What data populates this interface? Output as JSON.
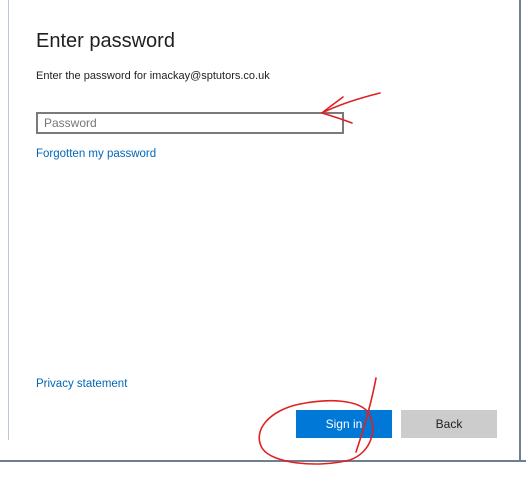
{
  "dialog": {
    "title": "Enter password",
    "subtitle": "Enter the password for imackay@sptutors.co.uk",
    "password_placeholder": "Password",
    "forgot_link": "Forgotten my password",
    "privacy_link": "Privacy statement"
  },
  "buttons": {
    "sign_in": "Sign in",
    "back": "Back"
  },
  "colors": {
    "accent": "#0078d7",
    "link": "#0067b8",
    "secondary_button": "#cccccc",
    "annotation": "#e02020"
  },
  "annotations": [
    "red-arrow-to-password-field",
    "red-circle-around-sign-in"
  ]
}
